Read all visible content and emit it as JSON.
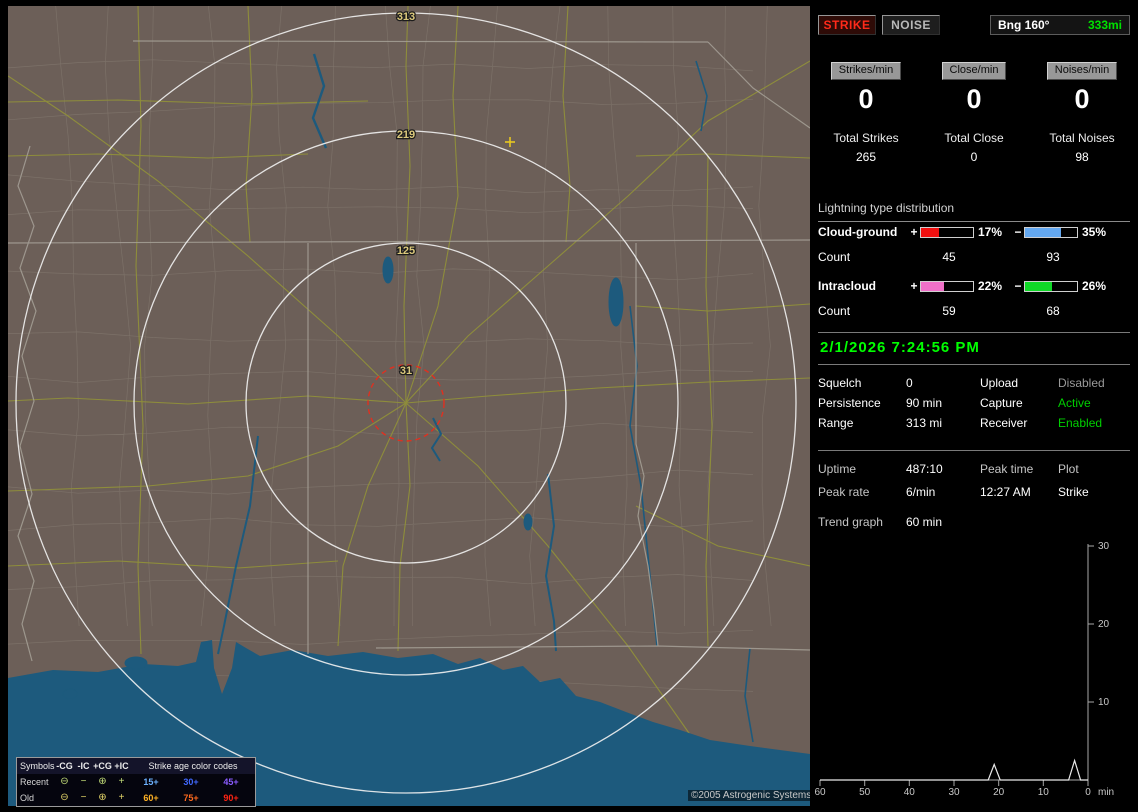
{
  "map": {
    "range_labels": [
      "313",
      "219",
      "125",
      "31"
    ],
    "copyright": "©2005 Astrogenic Systems",
    "legend": {
      "symbols_header": "Symbols",
      "col_headers": [
        "-CG",
        "-IC",
        "+CG",
        "+IC"
      ],
      "age_header": "Strike age color codes",
      "rows": [
        {
          "label": "Recent",
          "symbol_color": "#c2dc78",
          "symbols": [
            "⊖",
            "−",
            "⊕",
            "+"
          ],
          "ages": [
            {
              "label": "15+",
              "color": "#6db2ff"
            },
            {
              "label": "30+",
              "color": "#4169ff"
            },
            {
              "label": "45+",
              "color": "#8a5cff"
            }
          ]
        },
        {
          "label": "Old",
          "symbol_color": "#e2d468",
          "symbols": [
            "⊖",
            "−",
            "⊕",
            "+"
          ],
          "ages": [
            {
              "label": "60+",
              "color": "#ffb224"
            },
            {
              "label": "75+",
              "color": "#ff6a1e"
            },
            {
              "label": "90+",
              "color": "#ff2413"
            }
          ]
        }
      ]
    }
  },
  "panel": {
    "mode_buttons": [
      {
        "label": "STRIKE",
        "color": "#ff2a1a"
      },
      {
        "label": "NOISE",
        "color": "#b8b8b8"
      }
    ],
    "bearing": {
      "label": "Bng 160°",
      "value": "333mi",
      "value_color": "#00e000"
    },
    "rates": [
      {
        "label": "Strikes/min",
        "value": "0"
      },
      {
        "label": "Close/min",
        "value": "0"
      },
      {
        "label": "Noises/min",
        "value": "0"
      }
    ],
    "totals": [
      {
        "label": "Total Strikes",
        "value": "265"
      },
      {
        "label": "Total Close",
        "value": "0"
      },
      {
        "label": "Total Noises",
        "value": "98"
      }
    ],
    "distribution": {
      "title": "Lightning type distribution",
      "rows": [
        {
          "name": "Cloud-ground",
          "plus_sign": "+",
          "minus_sign": "−",
          "pos_pct": 17,
          "pos_pct_label": "17%",
          "pos_color": "#f01010",
          "neg_pct": 35,
          "neg_pct_label": "35%",
          "neg_color": "#64a8f0",
          "count_label": "Count",
          "pos_count": "45",
          "neg_count": "93"
        },
        {
          "name": "Intracloud",
          "plus_sign": "+",
          "minus_sign": "−",
          "pos_pct": 22,
          "pos_pct_label": "22%",
          "pos_color": "#f070c8",
          "neg_pct": 26,
          "neg_pct_label": "26%",
          "neg_color": "#10d828",
          "count_label": "Count",
          "pos_count": "59",
          "neg_count": "68"
        }
      ]
    },
    "clock": {
      "value": "2/1/2026 7:24:56 PM",
      "color": "#00ff00"
    },
    "settings": {
      "rows": [
        {
          "l1": "Squelch",
          "v1": "0",
          "l2": "Upload",
          "v2": "Disabled",
          "v2_color": "#9a9a9a"
        },
        {
          "l1": "Persistence",
          "v1": "90 min",
          "l2": "Capture",
          "v2": "Active",
          "v2_color": "#00d000"
        },
        {
          "l1": "Range",
          "v1": "313 mi",
          "l2": "Receiver",
          "v2": "Enabled",
          "v2_color": "#00d000"
        }
      ]
    },
    "stats": {
      "uptime_label": "Uptime",
      "uptime_value": "487:10",
      "peak_time_label": "Peak time",
      "peak_time_value": "12:27 AM",
      "plot_label": "Plot",
      "plot_value": "Strike",
      "peak_rate_label": "Peak rate",
      "peak_rate_value": "6/min",
      "trend_label": "Trend graph",
      "trend_value": "60 min"
    }
  },
  "chart_data": {
    "type": "line",
    "title": "Trend graph",
    "window_label": "60 min",
    "x_ticks": [
      "60",
      "50",
      "40",
      "30",
      "20",
      "10",
      "0"
    ],
    "x_unit": "min",
    "y_ticks": [
      "30",
      "20",
      "10"
    ],
    "y_max": 30,
    "x_max_minutes_ago": 60,
    "grid": false,
    "legend_position": "none",
    "series": [
      {
        "name": "Strike",
        "baseline": 0,
        "points_minutes_ago": [
          21,
          3
        ],
        "points_per_min": [
          2,
          2.5
        ]
      }
    ]
  }
}
